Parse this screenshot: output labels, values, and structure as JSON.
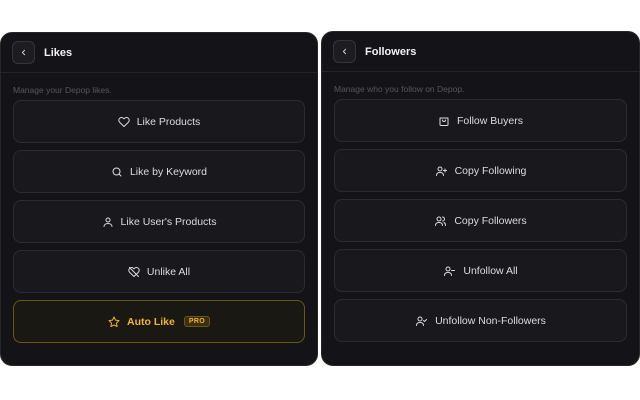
{
  "likes": {
    "title": "Likes",
    "subtitle": "Manage your Depop likes.",
    "buttons": [
      {
        "label": "Like Products",
        "icon": "heart-icon"
      },
      {
        "label": "Like by Keyword",
        "icon": "search-icon"
      },
      {
        "label": "Like User's Products",
        "icon": "user-icon"
      },
      {
        "label": "Unlike All",
        "icon": "heart-off-icon"
      },
      {
        "label": "Auto Like",
        "icon": "star-icon",
        "badge": "PRO"
      }
    ]
  },
  "followers": {
    "title": "Followers",
    "subtitle": "Manage who you follow on Depop.",
    "buttons": [
      {
        "label": "Follow Buyers",
        "icon": "shopping-bag-icon"
      },
      {
        "label": "Copy Following",
        "icon": "user-plus-icon"
      },
      {
        "label": "Copy Followers",
        "icon": "users-icon"
      },
      {
        "label": "Unfollow All",
        "icon": "user-minus-icon"
      },
      {
        "label": "Unfollow Non-Followers",
        "icon": "user-check-icon"
      }
    ]
  },
  "colors": {
    "panel_bg": "#141418",
    "button_bg": "#19191d",
    "accent_gold": "#f0b52a"
  }
}
